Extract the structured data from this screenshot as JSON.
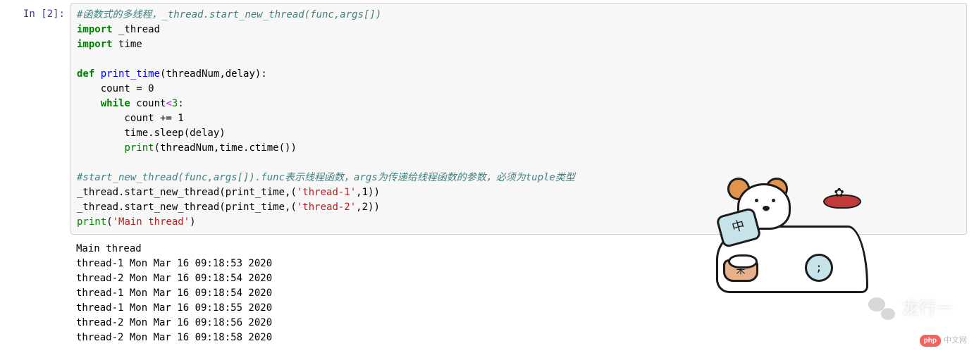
{
  "cell": {
    "prompt": "In [2]:",
    "code": {
      "line1_comment": "#函数式的多线程，_thread.start_new_thread(func,args[])",
      "line2_kw": "import",
      "line2_mod": " _thread",
      "line3_kw": "import",
      "line3_mod": " time",
      "blank1": "",
      "line5_def": "def",
      "line5_name_pre": " ",
      "line5_name": "print_time",
      "line5_sig": "(threadNum,delay):",
      "line6": "    count = 0",
      "line7_indent": "    ",
      "line7_while": "while",
      "line7_rest": " count",
      "line7_op": "<",
      "line7_num": "3",
      "line7_colon": ":",
      "line8": "        count += 1",
      "line9": "        time.sleep(delay)",
      "line10_indent": "        ",
      "line10_print": "print",
      "line10_args": "(threadNum,time.ctime())",
      "blank2": "",
      "line12_comment": "#start_new_thread(func,args[]).func表示线程函数，args为传递给线程函数的参数，必须为tuple类型",
      "line13_pre": "_thread.start_new_thread(print_time,(",
      "line13_str": "'thread-1'",
      "line13_post": ",1))",
      "line14_pre": "_thread.start_new_thread(print_time,(",
      "line14_str": "'thread-2'",
      "line14_post": ",2))",
      "line15_print": "print",
      "line15_open": "(",
      "line15_str": "'Main thread'",
      "line15_close": ")"
    },
    "output_lines": [
      "Main thread",
      "thread-1 Mon Mar 16 09:18:53 2020",
      "thread-2 Mon Mar 16 09:18:54 2020",
      "thread-1 Mon Mar 16 09:18:54 2020",
      "thread-1 Mon Mar 16 09:18:55 2020",
      "thread-2 Mon Mar 16 09:18:56 2020",
      "thread-2 Mon Mar 16 09:18:58 2020"
    ]
  },
  "decor": {
    "keyboard_char": "中",
    "ball_char": ";",
    "wechat_text": "龙行一",
    "php_pill": "php",
    "php_text": "中文网"
  }
}
